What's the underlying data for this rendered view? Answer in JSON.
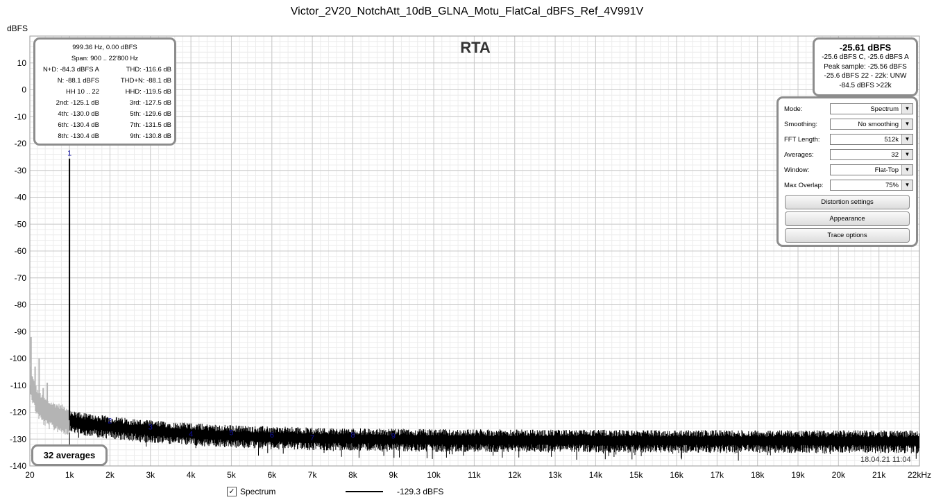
{
  "chart_data": {
    "type": "line",
    "title": "Victor_2V20_NotchAtt_10dB_GLNA_Motu_FlatCal_dBFS_Ref_4V991V",
    "watermark": "RTA",
    "ylabel": "dBFS",
    "xlabel": "",
    "xlim": [
      20,
      22000
    ],
    "ylim": [
      -140,
      20
    ],
    "x_scale": "linear",
    "grid": true,
    "x_ticks": [
      {
        "value": 20,
        "label": "20"
      },
      {
        "value": 1000,
        "label": "1k"
      },
      {
        "value": 2000,
        "label": "2k"
      },
      {
        "value": 3000,
        "label": "3k"
      },
      {
        "value": 4000,
        "label": "4k"
      },
      {
        "value": 5000,
        "label": "5k"
      },
      {
        "value": 6000,
        "label": "6k"
      },
      {
        "value": 7000,
        "label": "7k"
      },
      {
        "value": 8000,
        "label": "8k"
      },
      {
        "value": 9000,
        "label": "9k"
      },
      {
        "value": 10000,
        "label": "10k"
      },
      {
        "value": 11000,
        "label": "11k"
      },
      {
        "value": 12000,
        "label": "12k"
      },
      {
        "value": 13000,
        "label": "13k"
      },
      {
        "value": 14000,
        "label": "14k"
      },
      {
        "value": 15000,
        "label": "15k"
      },
      {
        "value": 16000,
        "label": "16k"
      },
      {
        "value": 17000,
        "label": "17k"
      },
      {
        "value": 18000,
        "label": "18k"
      },
      {
        "value": 19000,
        "label": "19k"
      },
      {
        "value": 20000,
        "label": "20k"
      },
      {
        "value": 21000,
        "label": "21k"
      },
      {
        "value": 22000,
        "label": "22kHz"
      }
    ],
    "y_ticks": [
      {
        "value": 10,
        "label": "10"
      },
      {
        "value": 0,
        "label": "0"
      },
      {
        "value": -10,
        "label": "-10"
      },
      {
        "value": -20,
        "label": "-20"
      },
      {
        "value": -30,
        "label": "-30"
      },
      {
        "value": -40,
        "label": "-40"
      },
      {
        "value": -50,
        "label": "-50"
      },
      {
        "value": -60,
        "label": "-60"
      },
      {
        "value": -70,
        "label": "-70"
      },
      {
        "value": -80,
        "label": "-80"
      },
      {
        "value": -90,
        "label": "-90"
      },
      {
        "value": -100,
        "label": "-100"
      },
      {
        "value": -110,
        "label": "-110"
      },
      {
        "value": -120,
        "label": "-120"
      },
      {
        "value": -130,
        "label": "-130"
      },
      {
        "value": -140,
        "label": "-140"
      }
    ],
    "series": [
      {
        "name": "Spectrum",
        "color": "#000000",
        "fundamental": {
          "x": 999.36,
          "y": -25.6
        },
        "noise_floor_points": [
          [
            1000,
            -123.5
          ],
          [
            2000,
            -125.5
          ],
          [
            3000,
            -127
          ],
          [
            4000,
            -128
          ],
          [
            5000,
            -128.8
          ],
          [
            6000,
            -129.3
          ],
          [
            8000,
            -130
          ],
          [
            10000,
            -130.3
          ],
          [
            15000,
            -130.6
          ],
          [
            22000,
            -130.8
          ]
        ]
      },
      {
        "name": "low-frequency noise",
        "color": "#b4b4b4",
        "points": [
          [
            20,
            -106
          ],
          [
            100,
            -112
          ],
          [
            200,
            -116
          ],
          [
            350,
            -119
          ],
          [
            500,
            -120.5
          ],
          [
            700,
            -121.5
          ],
          [
            900,
            -122.5
          ],
          [
            1000,
            -123
          ]
        ],
        "spikes": [
          [
            50,
            -92
          ],
          [
            150,
            -103
          ],
          [
            250,
            -100
          ],
          [
            350,
            -111
          ],
          [
            450,
            -109
          ]
        ]
      }
    ],
    "harmonic_markers": [
      {
        "label": "1",
        "x": 1000,
        "y": -25.6
      },
      {
        "label": "2",
        "x": 2000,
        "y": -125.1
      },
      {
        "label": "3",
        "x": 3000,
        "y": -127.5
      },
      {
        "label": "4",
        "x": 4000,
        "y": -130.0
      },
      {
        "label": "5",
        "x": 5000,
        "y": -129.6
      },
      {
        "label": "6",
        "x": 6000,
        "y": -130.4
      },
      {
        "label": "7",
        "x": 7000,
        "y": -131.5
      },
      {
        "label": "8",
        "x": 8000,
        "y": -130.4
      },
      {
        "label": "9",
        "x": 9000,
        "y": -130.8
      }
    ]
  },
  "distortion_panel": {
    "header1": "999.36 Hz, 0.00 dBFS",
    "header2": "Span: 900 .. 22'800 Hz",
    "rows": [
      {
        "left": "N+D: -84.3 dBFS A",
        "right": "THD: -116.6 dB"
      },
      {
        "left": "N: -88.1 dBFS",
        "right": "THD+N: -88.1 dB"
      },
      {
        "left": "HH 10 .. 22",
        "right": "HHD: -119.5 dB"
      },
      {
        "left": "2nd: -125.1 dB",
        "right": "3rd: -127.5 dB"
      },
      {
        "left": "4th: -130.0 dB",
        "right": "5th: -129.6 dB"
      },
      {
        "left": "6th: -130.4 dB",
        "right": "7th: -131.5 dB"
      },
      {
        "left": "8th: -130.4 dB",
        "right": "9th: -130.8 dB"
      }
    ]
  },
  "level_panel": {
    "main": "-25.61 dBFS",
    "line1": "-25.6 dBFS C, -25.6 dBFS A",
    "line2": "Peak sample: -25.56 dBFS",
    "line3": "-25.6 dBFS 22 - 22k: UNW",
    "line4": "-84.5 dBFS >22k"
  },
  "controls": [
    {
      "label": "Mode:",
      "value": "Spectrum"
    },
    {
      "label": "Smoothing:",
      "value": "No  smoothing"
    },
    {
      "label": "FFT Length:",
      "value": "512k"
    },
    {
      "label": "Averages:",
      "value": "32"
    },
    {
      "label": "Window:",
      "value": "Flat-Top"
    },
    {
      "label": "Max Overlap:",
      "value": "75%"
    }
  ],
  "buttons": {
    "distortion": "Distortion settings",
    "appearance": "Appearance",
    "trace": "Trace options"
  },
  "averages_label": "32 averages",
  "timestamp": "18.04.21 11:04",
  "legend": {
    "checkbox_label": "Spectrum",
    "value": "-129.3 dBFS",
    "checked": true
  }
}
